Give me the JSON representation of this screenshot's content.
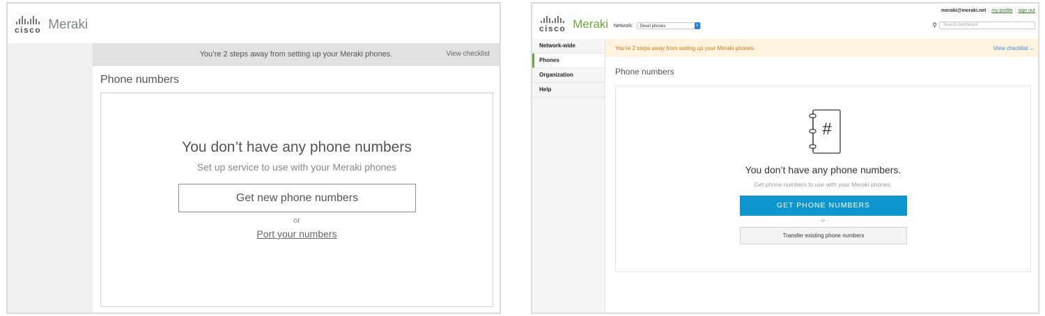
{
  "left": {
    "logo": {
      "cisco": "cisco",
      "meraki": "Meraki"
    },
    "banner": {
      "message": "You’re 2 steps away from setting up your Meraki phones.",
      "checklist": "View checklist"
    },
    "page_title": "Phone numbers",
    "empty_state": {
      "heading": "You don’t have any phone numbers",
      "subheading": "Set up service to use with your Meraki phones",
      "primary_button": "Get new phone numbers",
      "or": "or",
      "secondary_link": "Port your numbers"
    }
  },
  "right": {
    "logo": {
      "cisco": "cisco",
      "meraki": "Meraki"
    },
    "network": {
      "label": "Network:",
      "selected": "Devel phones"
    },
    "user": {
      "email": "meraki@meraki.net",
      "profile": "my profile",
      "signout": "sign out"
    },
    "search": {
      "placeholder": "Search dashboard",
      "icon": "search-icon"
    },
    "nav": [
      {
        "label": "Network-wide",
        "active": false
      },
      {
        "label": "Phones",
        "active": true
      },
      {
        "label": "Organization",
        "active": false
      },
      {
        "label": "Help",
        "active": false
      }
    ],
    "banner": {
      "message": "You’re 2 steps away from setting up your Meraki phones.",
      "checklist": "View checklist ⌵"
    },
    "page_title": "Phone numbers",
    "empty_state": {
      "icon": "phonebook-hash-icon",
      "icon_glyph": "#",
      "heading": "You don’t have any phone numbers.",
      "subheading": "Get phone numbers to use with your Meraki phones.",
      "primary_button": "GET PHONE NUMBERS",
      "or": "- or -",
      "secondary_button": "Transfer existing phone numbers"
    }
  },
  "colors": {
    "meraki_green": "#6aaa36",
    "primary_blue": "#0f96cf",
    "banner_orange_text": "#d77a1b",
    "banner_orange_bg": "#fdf3de",
    "link_blue": "#3f8ad6"
  }
}
